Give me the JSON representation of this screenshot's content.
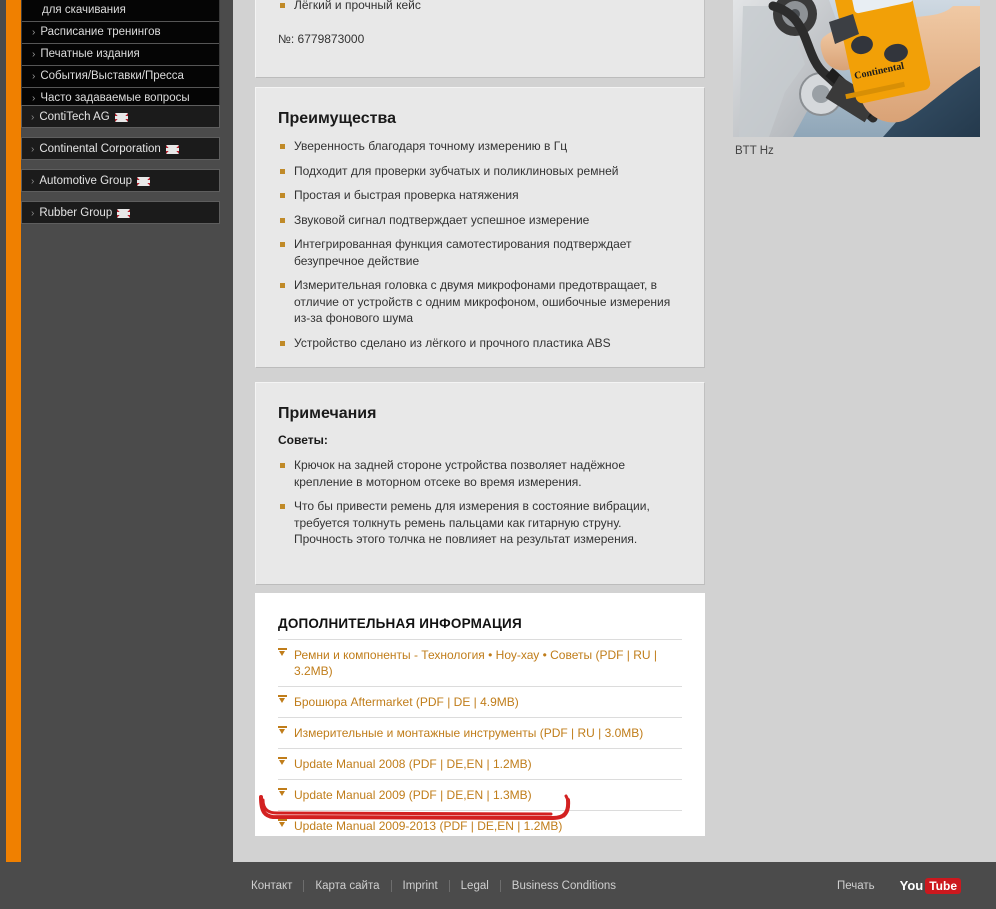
{
  "sidebar": {
    "nav_items": [
      {
        "label": "для скачивания",
        "chevron": false
      },
      {
        "label": "Расписание тренингов",
        "chevron": true
      },
      {
        "label": "Печатные издания",
        "chevron": true
      },
      {
        "label": "События/Выставки/Пресса",
        "chevron": true
      },
      {
        "label": "Часто задаваемые вопросы",
        "chevron": true
      }
    ],
    "external_items": [
      {
        "label": "ContiTech AG",
        "flag": "uk-flag-icon"
      },
      {
        "label": "Continental Corporation",
        "flag": "uk-flag-icon"
      },
      {
        "label": "Automotive Group",
        "flag": "uk-flag-icon"
      },
      {
        "label": "Rubber Group",
        "flag": "uk-flag-icon"
      }
    ]
  },
  "product_card": {
    "last_bullet": "Лёгкий и прочный кейс",
    "article_number": "№: 6779873000"
  },
  "advantages_card": {
    "title": "Преимущества",
    "bullets": [
      "Уверенность благодаря точному измерению в Гц",
      "Подходит для проверки зубчатых и поликлиновых ремней",
      "Простая и быстрая проверка натяжения",
      "Звуковой сигнал подтверждает успешное измерение",
      "Интегрированная функция самотестирования подтверждает безупречное действие",
      "Измерительная головка с двумя микрофонами предотвращает, в отличие от устройств с одним микрофоном, ошибочные измерения из-за фонового шума",
      "Устройство сделано из лёгкого и прочного пластика ABS"
    ]
  },
  "notes_card": {
    "title": "Примечания",
    "subtitle": "Советы:",
    "bullets": [
      "Крючок на задней стороне устройства позволяет надёжное крепление в моторном отсеке во время измерения.",
      "Что бы привести ремень для измерения в состояние вибрации, требуется толкнуть ремень пальцами как гитарную струну. Прочность этого толчка не повлияет на результат измерения."
    ]
  },
  "downloads_card": {
    "title": "ДОПОЛНИТЕЛЬНАЯ ИНФОРМАЦИЯ",
    "items": [
      "Ремни и компоненты - Технология • Ноу-хау • Советы (PDF | RU | 3.2MB)",
      "Брошюра Aftermarket (PDF | DE | 4.9MB)",
      "Измерительные и монтажные инструменты (PDF | RU | 3.0MB)",
      "Update Manual 2008 (PDF | DE,EN | 1.2MB)",
      "Update Manual 2009 (PDF | DE,EN | 1.3MB)",
      "Update Manual 2009-2013 (PDF | DE,EN | 1.2MB)"
    ],
    "highlighted_index": 5,
    "highlight_color": "#d32121"
  },
  "media": {
    "caption": "BTT Hz",
    "alt": "product-photo-belt-tension-tester"
  },
  "footer": {
    "links": [
      "Контакт",
      "Карта сайта",
      "Imprint",
      "Legal",
      "Business Conditions"
    ],
    "print_label": "Печать",
    "youtube": {
      "you": "You",
      "tube": "Tube"
    }
  },
  "colors": {
    "accent_orange": "#f08000",
    "link_orange": "#c07d1a",
    "bullet": "#c08a28",
    "annotation_red": "#d32121"
  }
}
